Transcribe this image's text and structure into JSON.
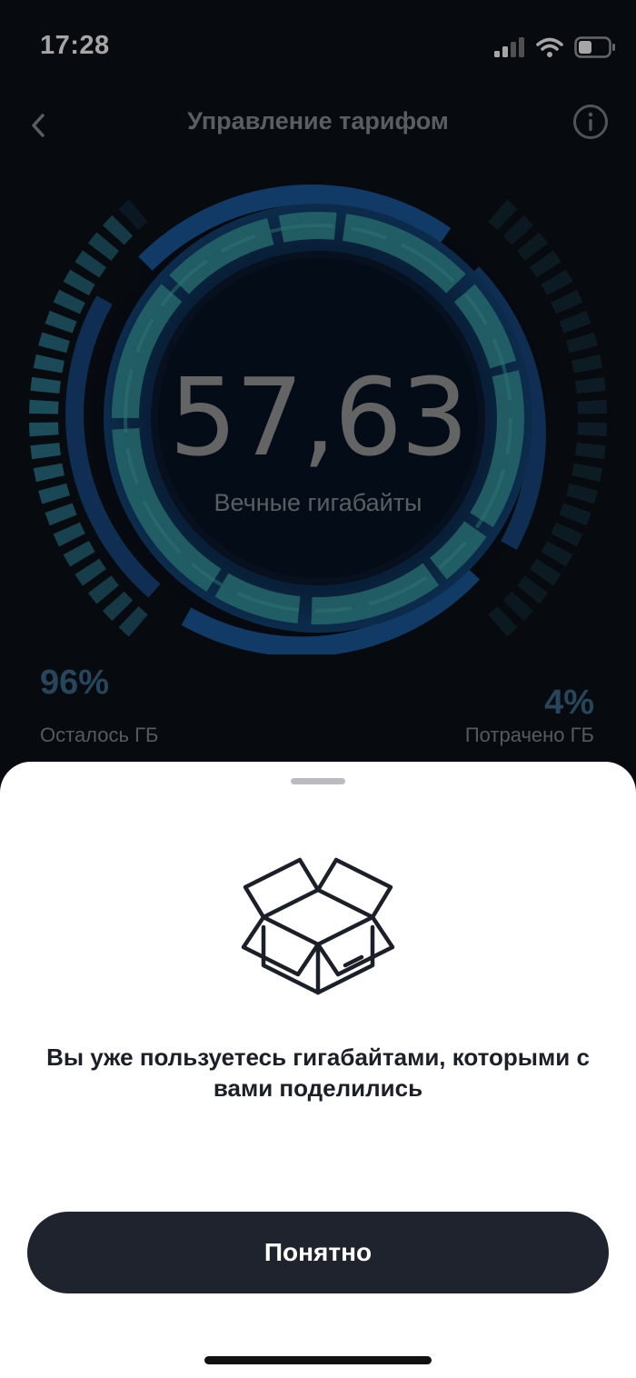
{
  "status_bar": {
    "time": "17:28",
    "icons": [
      "signal-icon",
      "wifi-icon",
      "battery-icon"
    ]
  },
  "header": {
    "title": "Управление тарифом",
    "back_icon": "chevron-left-icon",
    "info_icon": "info-icon"
  },
  "gauge": {
    "value": "57,63",
    "label": "Вечные гигабайты",
    "remaining_fraction": 0.96
  },
  "stats": {
    "left": {
      "value": "96%",
      "label": "Осталось ГБ"
    },
    "right": {
      "value": "4%",
      "label": "Потрачено ГБ"
    }
  },
  "sheet": {
    "icon": "open-box-icon",
    "message": "Вы уже пользуетесь гигабайтами, которыми с вами поделились",
    "button_label": "Понятно"
  },
  "colors": {
    "background": "#0c1119",
    "accent_teal": "#3aa6a8",
    "accent_blue": "#1c4f86",
    "stat_color": "#3c6c8d",
    "button_bg": "#1f232d"
  }
}
